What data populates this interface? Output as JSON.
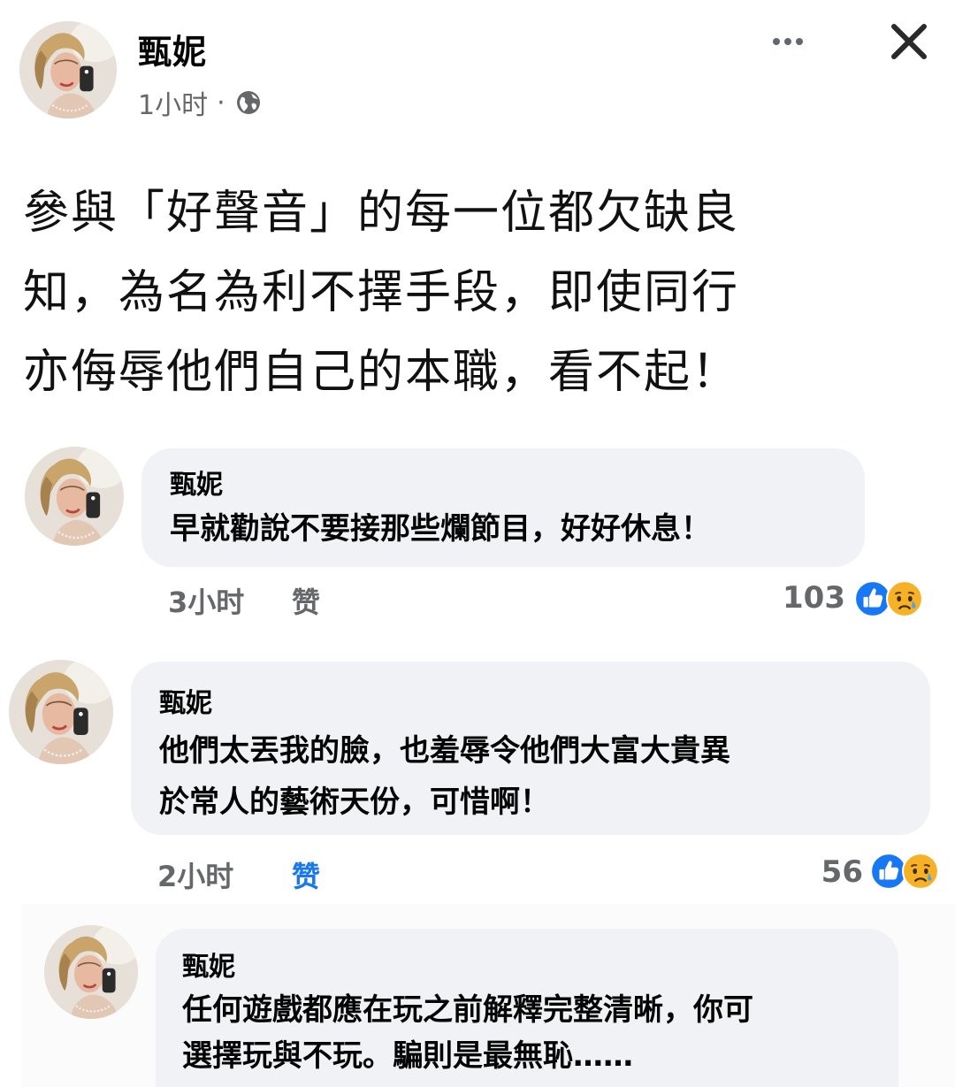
{
  "post": {
    "author": "甄妮",
    "time": "1小时",
    "separator": "·",
    "visibility_icon": "globe-icon",
    "text": "參與「好聲音」的每一位都欠缺良\n知，為名為利不擇手段，即使同行\n亦侮辱他們自己的本職，看不起！"
  },
  "header_actions": {
    "more_icon": "more-horizontal-icon",
    "close_icon": "close-icon"
  },
  "comments": [
    {
      "author": "甄妮",
      "text": "早就勸說不要接那些爛節目，好好休息！",
      "time": "3小时",
      "like_label": "赞",
      "reaction_count": "103",
      "reactions": [
        "like-reaction-icon",
        "sad-reaction-icon"
      ]
    },
    {
      "author": "甄妮",
      "text": "他們太丟我的臉，也羞辱令他們大富大貴異\n於常人的藝術天份，可惜啊！",
      "time": "2小时",
      "like_label": "赞",
      "reaction_count": "56",
      "reactions": [
        "like-reaction-icon",
        "sad-reaction-icon"
      ]
    },
    {
      "author": "甄妮",
      "text": "任何遊戲都應在玩之前解釋完整清晰，你可\n選擇玩與不玩。騙則是最無恥……"
    }
  ],
  "colors": {
    "bubble_bg": "#f0f2f5",
    "meta_gray": "#65676b",
    "like_blue": "#1877f2",
    "sad_yellow": "#f7b125"
  }
}
